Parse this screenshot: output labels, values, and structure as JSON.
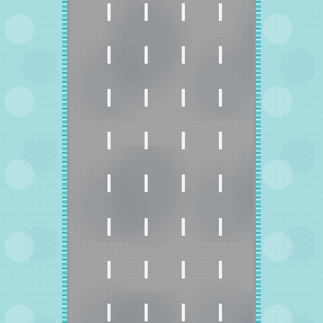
{
  "scene": {
    "type": "top-down road over water",
    "lanes": 5,
    "lane_markings": "dashed white",
    "colors": {
      "water": "#a8dde0",
      "shore": "#6fcfd6",
      "road": "#a3a3a3",
      "curb": "#9a9a9a",
      "lane_marking": "#f2f2f2"
    }
  }
}
